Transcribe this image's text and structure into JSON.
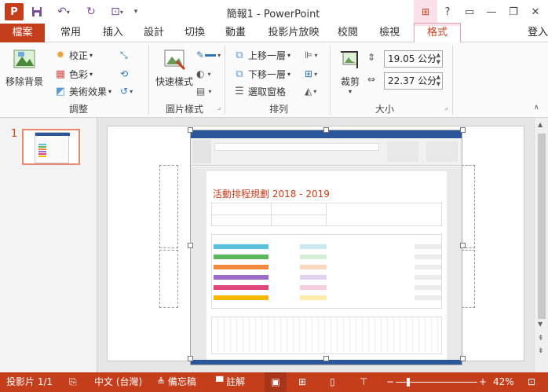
{
  "titlebar": {
    "app_icon": "P",
    "window_title": "簡報1 - PowerPoint",
    "help": "?",
    "ribbon_display": "▭",
    "minimize": "—",
    "restore": "❐",
    "close": "✕",
    "ctx_icon": "⊞"
  },
  "tabs": {
    "file": "檔案",
    "home": "常用",
    "insert": "插入",
    "design": "設計",
    "transitions": "切換",
    "animations": "動畫",
    "slideshow": "投影片放映",
    "review": "校閱",
    "view": "檢視",
    "format": "格式",
    "login": "登入"
  },
  "ribbon": {
    "remove_bg": "移除背景",
    "corrections": "校正",
    "color": "色彩",
    "artistic": "美術效果",
    "adjust_group": "調整",
    "quick_styles": "快速樣式",
    "picture_styles_group": "圖片樣式",
    "bring_forward": "上移一層",
    "send_backward": "下移一層",
    "selection_pane": "選取窗格",
    "arrange_group": "排列",
    "crop": "裁剪",
    "height": "19.05 公分",
    "width": "22.37 公分",
    "size_group": "大小"
  },
  "thumbnails": {
    "slide_number": "1"
  },
  "document": {
    "title": "活動排程規劃 2018 - 2019"
  },
  "status": {
    "slide": "投影片 1/1",
    "language": "中文 (台灣)",
    "notes": "備忘稿",
    "comments": "註解",
    "zoom": "42%"
  }
}
